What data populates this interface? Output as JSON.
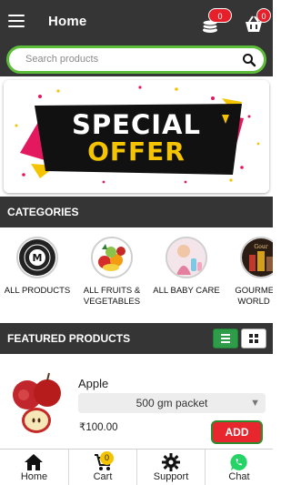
{
  "header": {
    "title": "Home",
    "menu_icon": "hamburger-menu-icon",
    "coins_icon": "coins-stack-icon",
    "coins_count": "0",
    "cart_icon": "shopping-basket-icon",
    "cart_count": "0"
  },
  "search": {
    "placeholder": "Search products",
    "value": "",
    "icon": "search-icon"
  },
  "banner": {
    "line1": "SPECIAL",
    "line2": "OFFER"
  },
  "categories": {
    "title": "CATEGORIES",
    "items": [
      {
        "label": "ALL PRODUCTS",
        "label2": "",
        "icon": "all-products-logo-icon"
      },
      {
        "label": "ALL FRUITS &",
        "label2": "VEGETABLES",
        "icon": "fruits-vegetables-icon"
      },
      {
        "label": "ALL BABY CARE",
        "label2": "",
        "icon": "baby-care-icon"
      },
      {
        "label": "GOURMET &",
        "label2": "WORLD FO",
        "icon": "gourmet-food-icon"
      }
    ]
  },
  "featured": {
    "title": "FEATURED PRODUCTS",
    "view_list_icon": "list-view-icon",
    "view_grid_icon": "grid-view-icon",
    "active_view": "list"
  },
  "product": {
    "name": "Apple",
    "variant": "500 gm packet",
    "price": "₹100.00",
    "add_label": "ADD"
  },
  "bottom_nav": {
    "items": [
      {
        "label": "Home",
        "icon": "home-icon"
      },
      {
        "label": "Cart",
        "icon": "cart-icon",
        "badge": "0"
      },
      {
        "label": "Support",
        "icon": "gear-icon"
      },
      {
        "label": "Chat",
        "icon": "whatsapp-icon"
      }
    ]
  },
  "colors": {
    "header_bg": "#353535",
    "accent_green": "#2e9c48",
    "search_border": "#5cbd3a",
    "badge_red": "#e5202a",
    "add_button": "#e8262e",
    "banner_pink": "#e4185e",
    "banner_yellow": "#f5c400"
  }
}
